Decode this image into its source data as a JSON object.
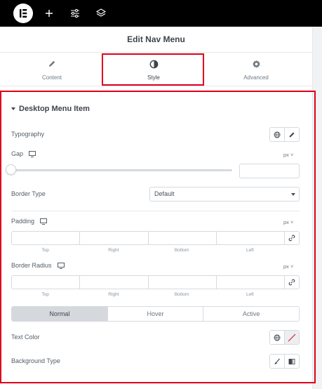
{
  "topbar": {
    "logo_icon": "elementor-logo-icon",
    "buttons": [
      "add-icon",
      "sliders-icon",
      "layers-icon"
    ]
  },
  "panel": {
    "title": "Edit Nav Menu",
    "tabs": [
      {
        "label": "Content",
        "icon": "pencil-icon"
      },
      {
        "label": "Style",
        "icon": "half-circle-icon",
        "active": true
      },
      {
        "label": "Advanced",
        "icon": "gear-icon"
      }
    ]
  },
  "section": {
    "title": "Desktop Menu Item",
    "typography_label": "Typography",
    "gap": {
      "label": "Gap",
      "unit": "px",
      "value": ""
    },
    "border_type": {
      "label": "Border Type",
      "selected": "Default"
    },
    "padding": {
      "label": "Padding",
      "unit": "px"
    },
    "border_radius": {
      "label": "Border Radius",
      "unit": "px"
    },
    "dimension_labels": [
      "Top",
      "Right",
      "Bottom",
      "Left"
    ],
    "states": [
      "Normal",
      "Hover",
      "Active"
    ],
    "active_state": "Normal",
    "text_color_label": "Text Color",
    "background_type_label": "Background Type"
  },
  "colors": {
    "highlight": "#e0001a",
    "topbar": "#000000",
    "active_state_bg": "#d5d8dc"
  }
}
